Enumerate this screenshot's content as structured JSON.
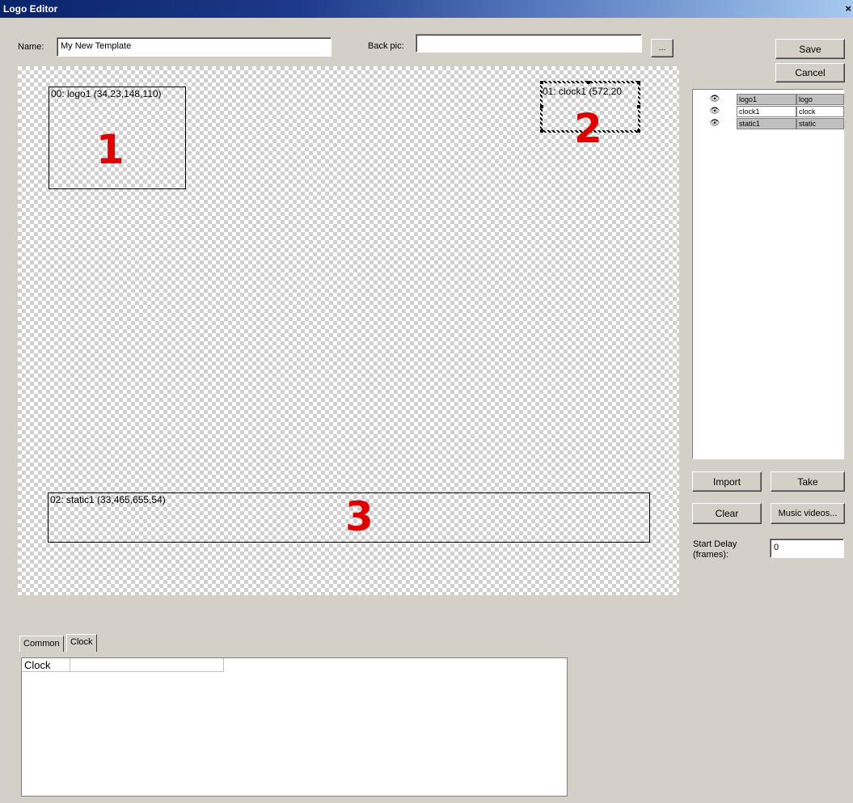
{
  "window": {
    "title": "Logo Editor",
    "close_glyph": "×"
  },
  "form": {
    "name_label": "Name:",
    "name_value": "My New Template",
    "backpic_label": "Back pic:",
    "backpic_value": "",
    "browse_label": "..."
  },
  "buttons": {
    "save": "Save",
    "cancel": "Cancel",
    "import": "Import",
    "take": "Take",
    "clear": "Clear",
    "music_videos": "Music videos..."
  },
  "canvas": {
    "regions": [
      {
        "label": "00: logo1 (34,23,148,110)",
        "marker": "1"
      },
      {
        "label": "01: clock1 (572,20",
        "marker": "2",
        "selected": true
      },
      {
        "label": "02: static1 (33,465,655,54)",
        "marker": "3"
      }
    ]
  },
  "layers": [
    {
      "name": "logo1",
      "type": "logo",
      "icon": "eye-icon"
    },
    {
      "name": "clock1",
      "type": "clock",
      "icon": "eye-icon"
    },
    {
      "name": "static1",
      "type": "static",
      "icon": "eye-icon"
    }
  ],
  "start_delay": {
    "label_line1": "Start Delay",
    "label_line2": "(frames):",
    "value": "0"
  },
  "tabs": [
    {
      "label": "Common",
      "active": false
    },
    {
      "label": "Clock",
      "active": true
    }
  ],
  "tab_content": {
    "header": "Clock"
  },
  "colors": {
    "accent_title": "#0a246a",
    "marker_red": "#e00000",
    "dialog_bg": "#d4d0c8"
  }
}
